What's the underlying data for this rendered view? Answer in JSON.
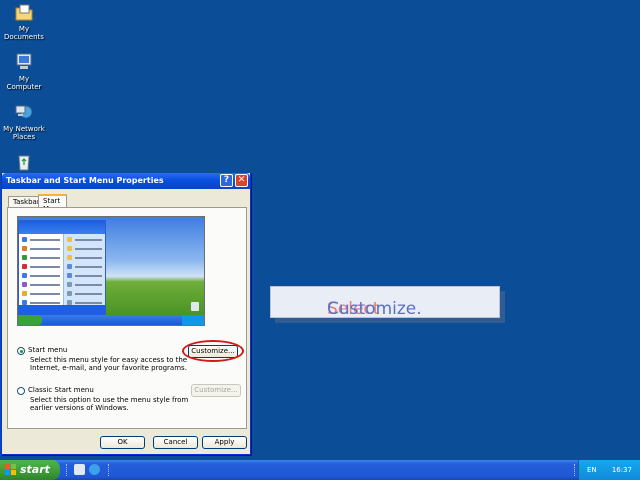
{
  "desktop": {
    "icons": [
      {
        "name": "my-documents-icon",
        "label": "My Documents"
      },
      {
        "name": "my-computer-icon",
        "label": "My Computer"
      },
      {
        "name": "my-network-places-icon",
        "label": "My Network Places"
      },
      {
        "name": "recycle-bin-icon",
        "label": ""
      }
    ]
  },
  "dialog": {
    "title": "Taskbar and Start Menu Properties",
    "tabs": [
      "Taskbar",
      "Start Menu"
    ],
    "active_tab": "Start Menu",
    "options": [
      {
        "label": "Start menu",
        "selected": true,
        "description": "Select this menu style for easy access to the Internet, e-mail, and your favorite programs.",
        "customize_label": "Customize...",
        "customize_enabled": true
      },
      {
        "label": "Classic Start menu",
        "selected": false,
        "description": "Select this option to use the menu style from earlier versions of Windows.",
        "customize_label": "Customize...",
        "customize_enabled": false
      }
    ],
    "buttons": {
      "ok": "OK",
      "cancel": "Cancel",
      "apply": "Apply"
    },
    "close_glyph": "✕",
    "help_glyph": "?"
  },
  "callout": {
    "word1": "Select",
    "word2": "Customize."
  },
  "taskbar": {
    "start_label": "start",
    "language": "EN",
    "clock": "16:37"
  },
  "colors": {
    "desktop": "#0b4d96",
    "highlight_ring": "#d21a1a",
    "taskbar": "#245edb",
    "start_button": "#3c9b38"
  }
}
